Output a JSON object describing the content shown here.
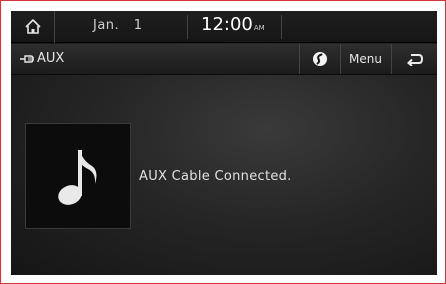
{
  "status_bar": {
    "home_icon": "home-icon",
    "date": "Jan. 1",
    "time": "12:00",
    "ampm": "AM"
  },
  "title_bar": {
    "source_icon": "aux-plug-icon",
    "source_label": "AUX",
    "circle_icon": "sound-settings-icon",
    "menu_label": "Menu",
    "back_icon": "back-arrow-icon"
  },
  "main": {
    "album_art_icon": "music-note-icon",
    "status_message": "AUX Cable Connected."
  },
  "colors": {
    "frame_border": "#d3343a",
    "screen_bg": "#262626",
    "text": "#e8e8e8"
  }
}
